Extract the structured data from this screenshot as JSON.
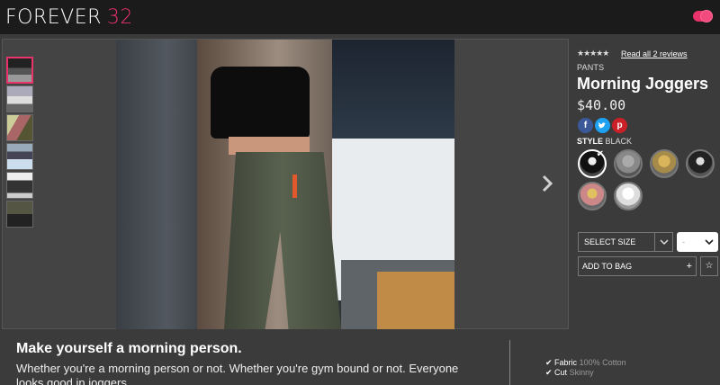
{
  "header": {
    "brand_word": "FOREVER",
    "brand_number": "32",
    "brand_color": "#e8336b"
  },
  "gallery": {
    "thumbnail_count": 6,
    "active_thumbnail": 1
  },
  "product": {
    "rating_stars": "★★★★★",
    "reviews_link": "Read all 2 reviews",
    "category": "PANTS",
    "name": "Morning Joggers",
    "price": "$40.00",
    "social": {
      "facebook": "f",
      "twitter": "t",
      "pinterest": "p"
    },
    "style_label": "STYLE",
    "style_value": "BLACK",
    "swatch_count": 6,
    "selected_swatch": 1,
    "size_select": "SELECT SIZE",
    "quantity_select": "-",
    "add_to_bag": "ADD TO BAG",
    "add_icon": "+",
    "wishlist_icon": "☆"
  },
  "description": {
    "heading": "Make yourself a morning person.",
    "body": "Whether you're a morning person or not. Whether you're gym bound or not. Everyone looks good in joggers."
  },
  "details": [
    {
      "key": "Fabric",
      "value": "100% Cotton"
    },
    {
      "key": "Cut",
      "value": "Skinny"
    }
  ]
}
